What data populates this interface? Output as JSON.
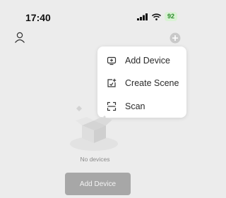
{
  "status_bar": {
    "time": "17:40",
    "battery": "92",
    "icons": [
      "signal-icon",
      "wifi-icon",
      "battery-icon"
    ]
  },
  "header": {
    "profile_icon": "profile-icon",
    "add_icon": "add-icon"
  },
  "dropdown": {
    "items": [
      {
        "label": "Add Device",
        "icon": "add-device-icon"
      },
      {
        "label": "Create Scene",
        "icon": "create-scene-icon"
      },
      {
        "label": "Scan",
        "icon": "scan-icon"
      }
    ]
  },
  "empty_state": {
    "message": "No devices",
    "button_label": "Add Device"
  },
  "colors": {
    "background": "#ececec",
    "menu_background": "#ffffff",
    "button_background": "#a7a7a7",
    "battery_background": "#d9f2d4",
    "battery_text": "#2a8a2a"
  }
}
